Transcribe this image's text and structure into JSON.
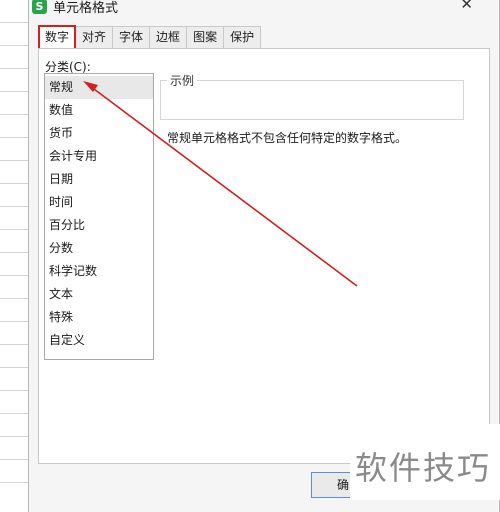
{
  "window": {
    "title": "单元格格式",
    "app_icon_glyph": "S"
  },
  "tabs": [
    {
      "label": "数字",
      "active": true
    },
    {
      "label": "对齐",
      "active": false
    },
    {
      "label": "字体",
      "active": false
    },
    {
      "label": "边框",
      "active": false
    },
    {
      "label": "图案",
      "active": false
    },
    {
      "label": "保护",
      "active": false
    }
  ],
  "category": {
    "label": "分类(C):",
    "items": [
      "常规",
      "数值",
      "货币",
      "会计专用",
      "日期",
      "时间",
      "百分比",
      "分数",
      "科学记数",
      "文本",
      "特殊",
      "自定义"
    ],
    "selected": "常规"
  },
  "sample": {
    "legend": "示例"
  },
  "description": "常规单元格格式不包含任何特定的数字格式。",
  "buttons": {
    "ok_label": "确"
  },
  "watermark": "软件技巧",
  "annotation_color": "#d02020"
}
